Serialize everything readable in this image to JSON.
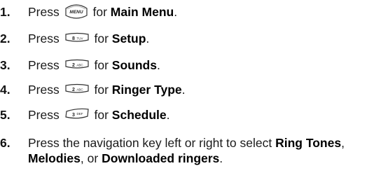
{
  "steps": [
    {
      "number": "1.",
      "prefix": "Press",
      "key": "MENU",
      "suffix": "for",
      "target": "Main Menu",
      "end": "."
    },
    {
      "number": "2.",
      "prefix": "Press",
      "key": "8 TUV",
      "suffix": "for",
      "target": "Setup",
      "end": "."
    },
    {
      "number": "3.",
      "prefix": "Press",
      "key": "2 ABC",
      "suffix": "for",
      "target": "Sounds",
      "end": "."
    },
    {
      "number": "4.",
      "prefix": "Press",
      "key": "2 ABC",
      "suffix": "for",
      "target": "Ringer Type",
      "end": "."
    },
    {
      "number": "5.",
      "prefix": "Press",
      "key": "3 DEF",
      "suffix": "for",
      "target": "Schedule",
      "end": "."
    },
    {
      "number": "6.",
      "line1": "Press the navigation key left or right to select",
      "opt1": "Ring Tones",
      "comma": ",",
      "opt2": "Melodies",
      "or": ", or",
      "opt3": "Downloaded ringers",
      "end": "."
    }
  ],
  "keys": {
    "menu": {
      "label": "MENU"
    },
    "k8": {
      "digit": "8",
      "letters": "TUV"
    },
    "k2": {
      "digit": "2",
      "letters": "ABC"
    },
    "k3": {
      "digit": "3",
      "letters": "DEF"
    }
  }
}
